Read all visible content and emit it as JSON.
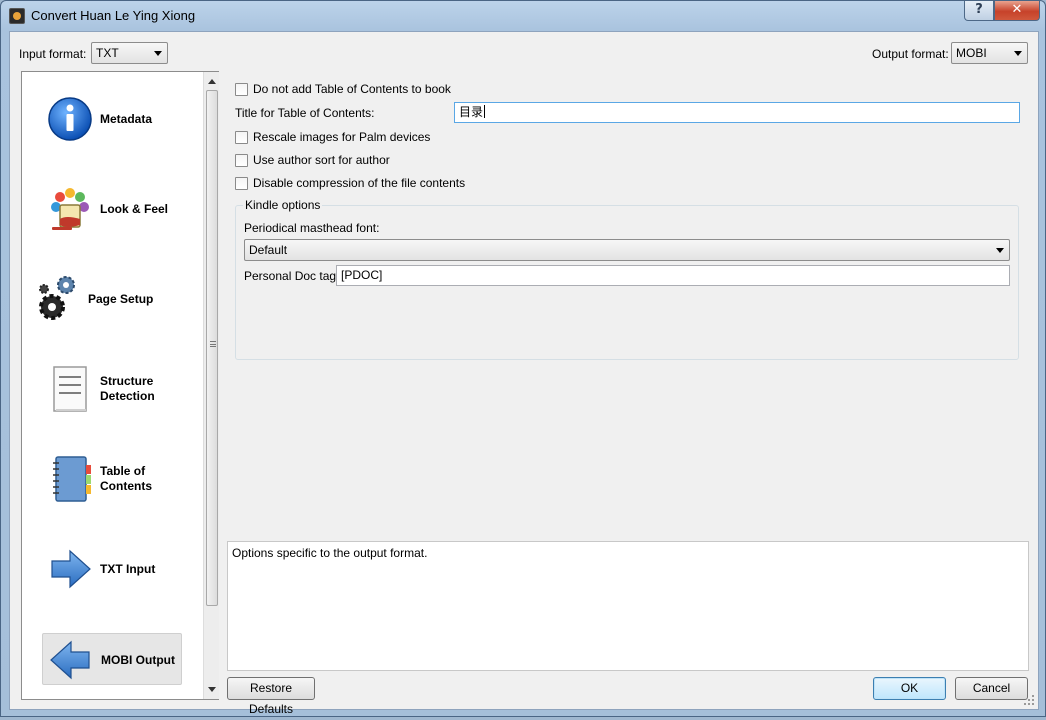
{
  "window": {
    "title": "Convert Huan Le Ying Xiong",
    "help_glyph": "?",
    "close_glyph": "✕"
  },
  "top": {
    "input_format_label": "Input format:",
    "input_format_value": "TXT",
    "output_format_label": "Output format:",
    "output_format_value": "MOBI"
  },
  "sidebar": {
    "items": [
      {
        "label": "Metadata",
        "icon": "info-icon"
      },
      {
        "label": "Look & Feel",
        "icon": "paint-bucket-icon"
      },
      {
        "label": "Page Setup",
        "icon": "gears-icon"
      },
      {
        "label": "Structure Detection",
        "icon": "document-icon"
      },
      {
        "label": "Table of Contents",
        "icon": "notebook-icon"
      },
      {
        "label": "TXT Input",
        "icon": "arrow-right-icon"
      },
      {
        "label": "MOBI Output",
        "icon": "arrow-left-icon",
        "selected": true
      }
    ]
  },
  "options": {
    "no_toc_label": "Do not add Table of Contents to book",
    "toc_title_label": "Title for Table of Contents:",
    "toc_title_value": "目录",
    "rescale_label": "Rescale images for Palm devices",
    "author_sort_label": "Use author sort for author",
    "disable_compression_label": "Disable compression of the file contents"
  },
  "kindle": {
    "group_title": "Kindle options",
    "masthead_label": "Periodical masthead font:",
    "masthead_value": "Default",
    "doc_tag_label": "Personal Doc tag:",
    "doc_tag_value": "[PDOC]"
  },
  "description": "Options specific to the output format.",
  "buttons": {
    "restore_defaults": "Restore Defaults",
    "ok": "OK",
    "cancel": "Cancel"
  },
  "colors": {
    "title_bar": "#a9c3de",
    "close_button": "#c7422a",
    "dialog_bg": "#f0f0f0",
    "focus_border": "#5aa7e5"
  }
}
